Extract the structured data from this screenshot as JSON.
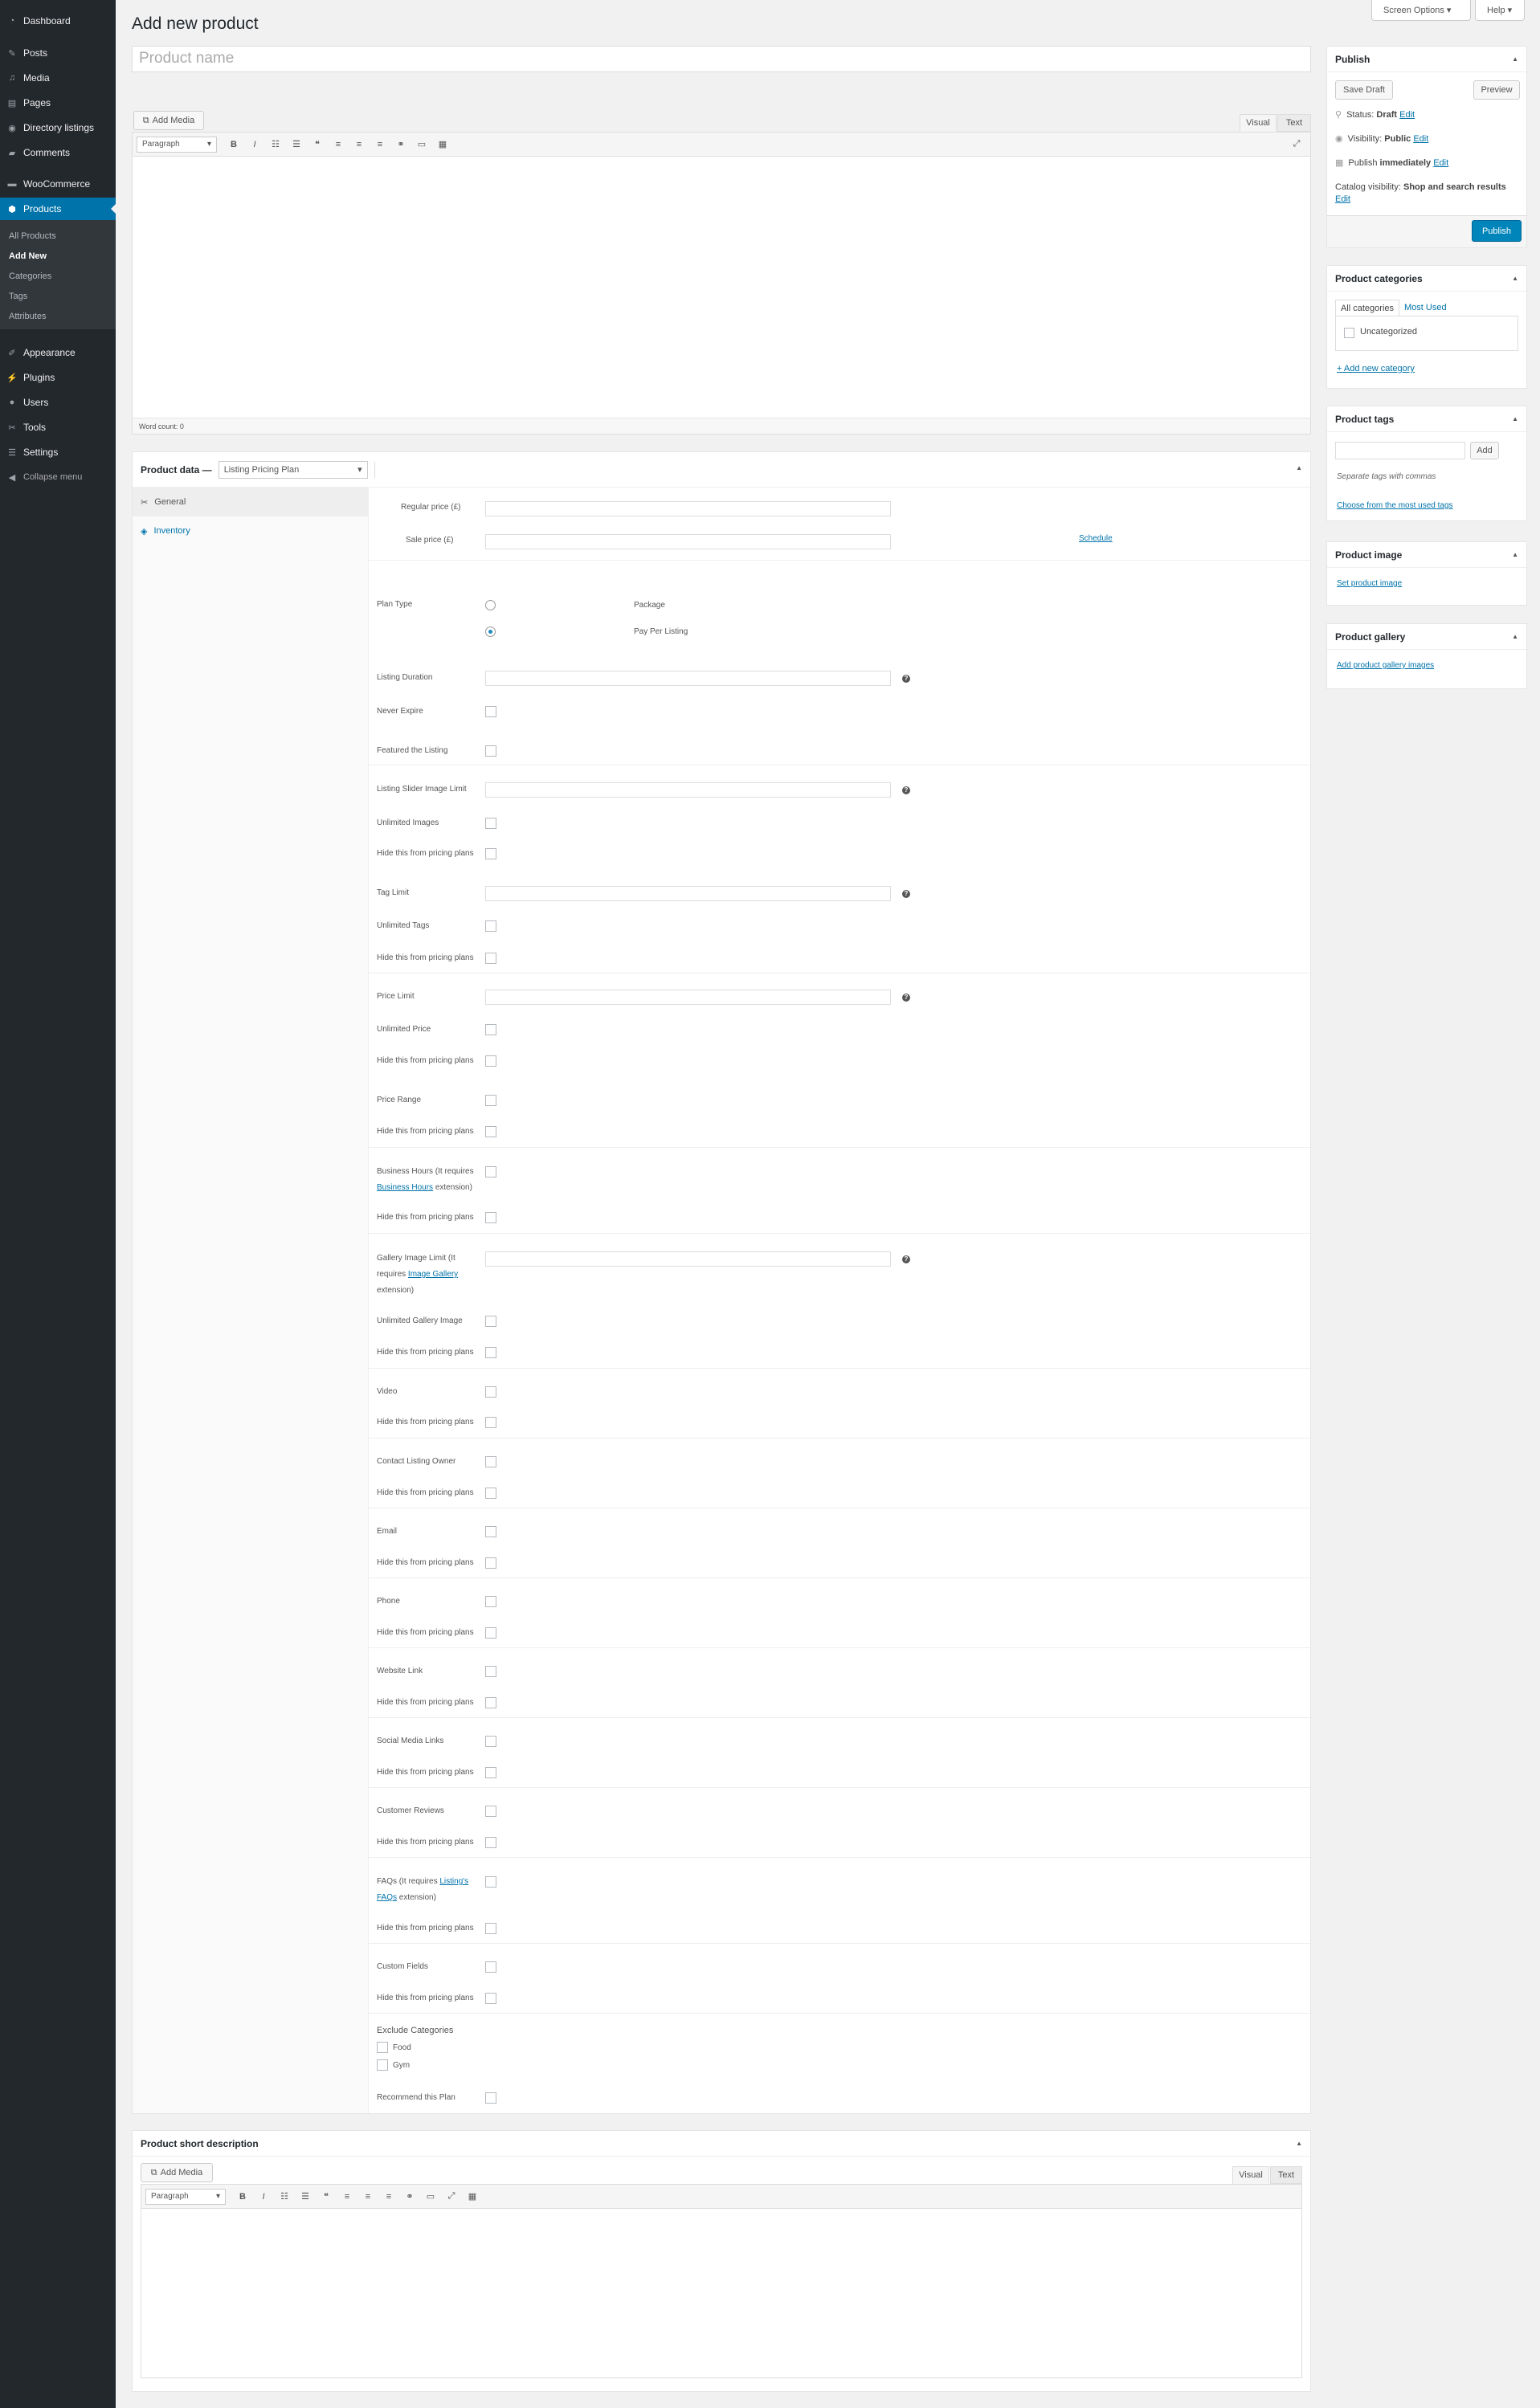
{
  "menu": {
    "dashboard": "Dashboard",
    "posts": "Posts",
    "media": "Media",
    "pages": "Pages",
    "directory": "Directory listings",
    "comments": "Comments",
    "woocommerce": "WooCommerce",
    "products": "Products",
    "all_products": "All Products",
    "add_new": "Add New",
    "categories": "Categories",
    "tags": "Tags",
    "attributes": "Attributes",
    "appearance": "Appearance",
    "plugins": "Plugins",
    "users": "Users",
    "tools": "Tools",
    "settings": "Settings",
    "collapse": "Collapse menu"
  },
  "header": {
    "title": "Add new product",
    "screen_options": "Screen Options ▾",
    "help": "Help ▾"
  },
  "title_field": {
    "placeholder": "Product name"
  },
  "editor": {
    "add_media": "Add Media",
    "tab_visual": "Visual",
    "tab_text": "Text",
    "format": "Paragraph",
    "word_count": "Word count: 0"
  },
  "product_data": {
    "label": "Product data —",
    "type": "Listing Pricing Plan",
    "tab_general": "General",
    "tab_inventory": "Inventory",
    "regular_price": "Regular price (£)",
    "sale_price": "Sale price (£)",
    "schedule": "Schedule",
    "plan_type": "Plan Type",
    "plan_package": "Package",
    "plan_ppl": "Pay Per Listing",
    "listing_duration": "Listing Duration",
    "never_expire": "Never Expire",
    "featured": "Featured the Listing",
    "slider_limit": "Listing Slider Image Limit",
    "unlimited_images": "Unlimited Images",
    "hide": "Hide this from pricing plans",
    "tag_limit": "Tag Limit",
    "unlimited_tags": "Unlimited Tags",
    "price_limit": "Price Limit",
    "unlimited_price": "Unlimited Price",
    "price_range": "Price Range",
    "bh_1": "Business Hours (It requires",
    "bh_link": "Business Hours",
    "bh_2": "extension)",
    "gl_1": "Gallery Image Limit (It",
    "gl_2": "requires",
    "gl_link": "Image Gallery",
    "gl_3": "extension)",
    "unlimited_gallery": "Unlimited Gallery Image",
    "video": "Video",
    "contact": "Contact Listing Owner",
    "email": "Email",
    "phone": "Phone",
    "website": "Website Link",
    "social": "Social Media Links",
    "reviews": "Customer Reviews",
    "faq_1": "FAQs (It requires",
    "faq_link": "Listing's",
    "faq_link2": "FAQs",
    "faq_2": "extension)",
    "custom_fields": "Custom Fields",
    "exclude": "Exclude Categories",
    "cat_food": "Food",
    "cat_gym": "Gym",
    "recommend": "Recommend this Plan"
  },
  "short_desc": {
    "title": "Product short description",
    "add_media": "Add Media",
    "tab_visual": "Visual",
    "tab_text": "Text",
    "format": "Paragraph"
  },
  "publish": {
    "title": "Publish",
    "save_draft": "Save Draft",
    "preview": "Preview",
    "status_label": "Status:",
    "status": "Draft",
    "visibility_label": "Visibility:",
    "visibility": "Public",
    "publish_label": "Publish",
    "publish_when": "immediately",
    "edit": "Edit",
    "catalog_label": "Catalog visibility:",
    "catalog": "Shop and search results",
    "button": "Publish"
  },
  "categories": {
    "title": "Product categories",
    "tab_all": "All categories",
    "tab_most": "Most Used",
    "uncategorized": "Uncategorized",
    "add_new": "+ Add new category"
  },
  "tags": {
    "title": "Product tags",
    "add": "Add",
    "hint": "Separate tags with commas",
    "choose": "Choose from the most used tags"
  },
  "image": {
    "title": "Product image",
    "set": "Set product image"
  },
  "gallery": {
    "title": "Product gallery",
    "add": "Add product gallery images"
  }
}
